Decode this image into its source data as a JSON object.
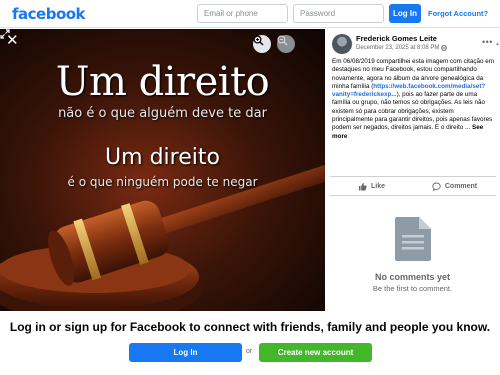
{
  "header": {
    "logo": "facebook",
    "email_placeholder": "Email or phone",
    "password_placeholder": "Password",
    "login_label": "Log In",
    "forgot_label": "Forgot Account?"
  },
  "photo": {
    "line1": "Um direito",
    "line2": "não é o que alguém deve te dar",
    "line3": "Um direito",
    "line4": "é o que ninguém pode te negar"
  },
  "post": {
    "author": "Frederick Gomes Leite",
    "date": "December 23, 2025 at 8:08 PM",
    "privacy_icon": "globe-icon",
    "text_before_link": "Em 06/08/2019 compartilhei esta imagem com citação em destaques no meu Facebook, estou compartilhando novamente, agora no álbum da árvore genealógica da minha família (",
    "link": "https://web.facebook.com/media/set?vanity=frederickexp...",
    "text_after_link": "), pois ao fazer parte de uma família ou grupo, não temos só obrigações. As leis não existem só para cobrar obrigações, existem principalmente para garantir direitos, pois apenas favores podem ser negados, direitos jamais. E o direito ...",
    "see_more": "See more",
    "like_label": "Like",
    "comment_label": "Comment",
    "no_comments": "No comments yet",
    "be_first": "Be the first to comment."
  },
  "footer": {
    "cta": "Log in or sign up for Facebook to connect with friends, family and people you know.",
    "login_label": "Log In",
    "or": "or",
    "create_label": "Create new account"
  },
  "colors": {
    "brand": "#1877f2",
    "create_green": "#42b72a",
    "link": "#216fdb"
  }
}
